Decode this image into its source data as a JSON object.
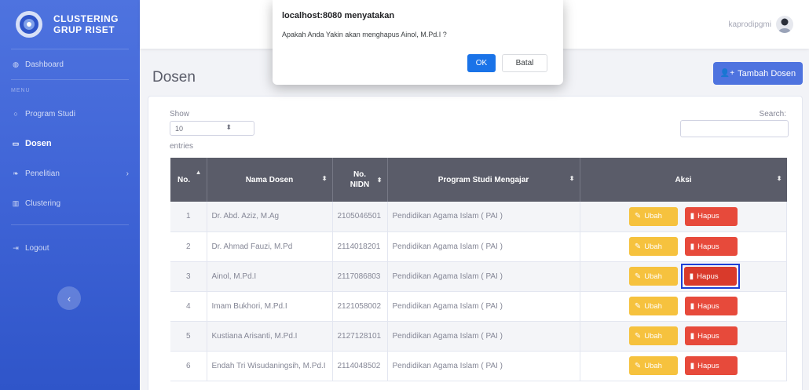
{
  "sidebar": {
    "brand_line1": "CLUSTERING",
    "brand_line2": "GRUP RISET",
    "dashboard": "Dashboard",
    "heading": "MENU",
    "items": [
      {
        "label": "Program Studi",
        "icon": "circle-icon"
      },
      {
        "label": "Dosen",
        "icon": "chalkboard-icon"
      },
      {
        "label": "Penelitian",
        "icon": "leaf-icon"
      },
      {
        "label": "Clustering",
        "icon": "bars-icon"
      }
    ],
    "logout": "Logout",
    "toggle_icon": "‹"
  },
  "topbar": {
    "username": "kaprodipgmi"
  },
  "page": {
    "title": "Dosen",
    "add_button": "Tambah Dosen"
  },
  "table_controls": {
    "show_label": "Show",
    "page_length": "10",
    "entries_label": "entries",
    "search_label": "Search:"
  },
  "table": {
    "headers": [
      "No.",
      "Nama Dosen",
      "No.",
      "NIDN",
      "Program Studi Mengajar",
      "Aksi"
    ],
    "edit_label": "Ubah",
    "delete_label": "Hapus",
    "rows": [
      {
        "no": "1",
        "nama": "Dr. Abd. Aziz, M.Ag",
        "nidn": "2105046501",
        "prodi": "Pendidikan Agama Islam ( PAI )"
      },
      {
        "no": "2",
        "nama": "Dr. Ahmad Fauzi, M.Pd",
        "nidn": "2114018201",
        "prodi": "Pendidikan Agama Islam ( PAI )"
      },
      {
        "no": "3",
        "nama": "Ainol, M.Pd.I",
        "nidn": "2117086803",
        "prodi": "Pendidikan Agama Islam ( PAI )"
      },
      {
        "no": "4",
        "nama": "Imam Bukhori, M.Pd.I",
        "nidn": "2121058002",
        "prodi": "Pendidikan Agama Islam ( PAI )"
      },
      {
        "no": "5",
        "nama": "Kustiana Arisanti, M.Pd.I",
        "nidn": "2127128101",
        "prodi": "Pendidikan Agama Islam ( PAI )"
      },
      {
        "no": "6",
        "nama": "Endah Tri Wisudaningsih, M.Pd.I",
        "nidn": "2114048502",
        "prodi": "Pendidikan Agama Islam ( PAI )"
      }
    ]
  },
  "dialog": {
    "title": "localhost:8080 menyatakan",
    "message": "Apakah Anda Yakin akan menghapus Ainol, M.Pd.I ?",
    "ok": "OK",
    "cancel": "Batal"
  }
}
